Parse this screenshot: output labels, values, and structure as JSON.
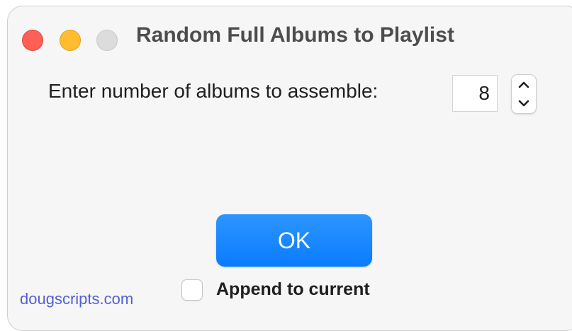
{
  "window": {
    "title": "Random Full Albums to Playlist"
  },
  "prompt": {
    "label": "Enter number of albums to assemble:",
    "value": "8"
  },
  "icons": {
    "close": "close-button-red-circle",
    "minimize": "minimize-button-yellow-circle",
    "zoom": "zoom-button-gray-circle",
    "stepper_up": "chevron-up-icon",
    "stepper_down": "chevron-down-icon"
  },
  "buttons": {
    "ok_label": "OK"
  },
  "options": {
    "append_label": "Append to current",
    "append_checked": false
  },
  "footer": {
    "link_text": "dougscripts.com"
  },
  "colors": {
    "accent": "#0a7cff",
    "close": "#fe5f57",
    "minimize": "#febc2e",
    "zoom": "#dcdcdc",
    "link": "#5260d6"
  }
}
